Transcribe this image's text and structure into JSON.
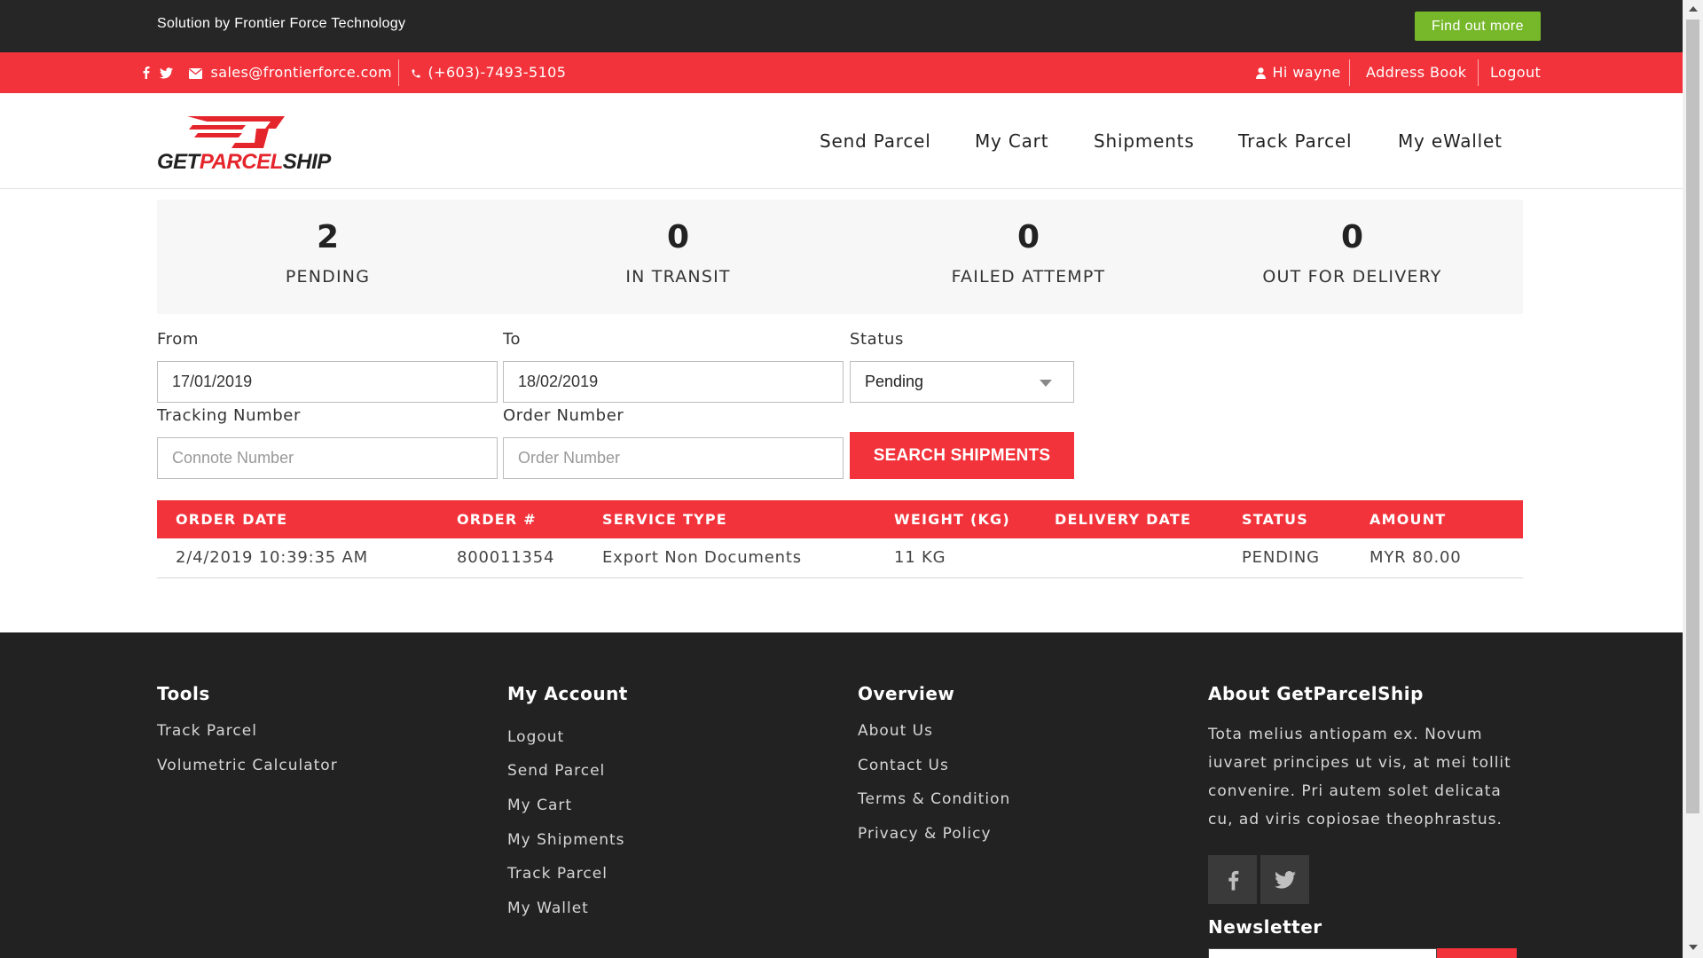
{
  "topbar": {
    "solution_text": "Solution by Frontier Force Technology",
    "find_out_label": "Find out more"
  },
  "contact": {
    "email": "sales@frontierforce.com",
    "phone": "(+603)-7493-5105",
    "greeting": "Hi wayne",
    "address_book": "Address Book",
    "logout": "Logout"
  },
  "brand": {
    "part1": "GET",
    "part2": "PARCEL",
    "part3": "SHIP",
    "accent_color": "#f2333b"
  },
  "nav": {
    "items": [
      "Send Parcel",
      "My Cart",
      "Shipments",
      "Track Parcel",
      "My eWallet"
    ]
  },
  "stats": [
    {
      "value": "2",
      "label": "PENDING"
    },
    {
      "value": "0",
      "label": "IN TRANSIT"
    },
    {
      "value": "0",
      "label": "FAILED ATTEMPT"
    },
    {
      "value": "0",
      "label": "OUT FOR DELIVERY"
    }
  ],
  "filters": {
    "from_label": "From",
    "from_value": "17/01/2019",
    "to_label": "To",
    "to_value": "18/02/2019",
    "status_label": "Status",
    "status_value": "Pending",
    "tracking_label": "Tracking Number",
    "tracking_placeholder": "Connote Number",
    "order_label": "Order Number",
    "order_placeholder": "Order Number",
    "search_label": "SEARCH SHIPMENTS"
  },
  "table": {
    "headers": [
      "ORDER DATE",
      "ORDER #",
      "SERVICE TYPE",
      "WEIGHT (KG)",
      "DELIVERY DATE",
      "STATUS",
      "AMOUNT"
    ],
    "rows": [
      [
        "2/4/2019 10:39:35 AM",
        "800011354",
        "Export Non Documents",
        "11 KG",
        "",
        "PENDING",
        "MYR 80.00"
      ]
    ]
  },
  "footer": {
    "tools": {
      "title": "Tools",
      "links": [
        "Track Parcel",
        "Volumetric Calculator"
      ]
    },
    "account": {
      "title": "My Account",
      "links": [
        "Logout",
        "Send Parcel",
        "My Cart",
        "My Shipments",
        "Track Parcel",
        "My Wallet"
      ]
    },
    "overview": {
      "title": "Overview",
      "links": [
        "About Us",
        "Contact Us",
        "Terms & Condition",
        "Privacy & Policy"
      ]
    },
    "about": {
      "title": "About GetParcelShip",
      "text": "Tota melius antiopam ex. Novum iuvaret principes ut vis, at mei tollit convenire. Pri autem solet delicata cu, ad viris copiosae theophrastus.",
      "social": [
        "facebook-icon",
        "twitter-icon"
      ],
      "newsletter_title": "Newsletter"
    }
  }
}
